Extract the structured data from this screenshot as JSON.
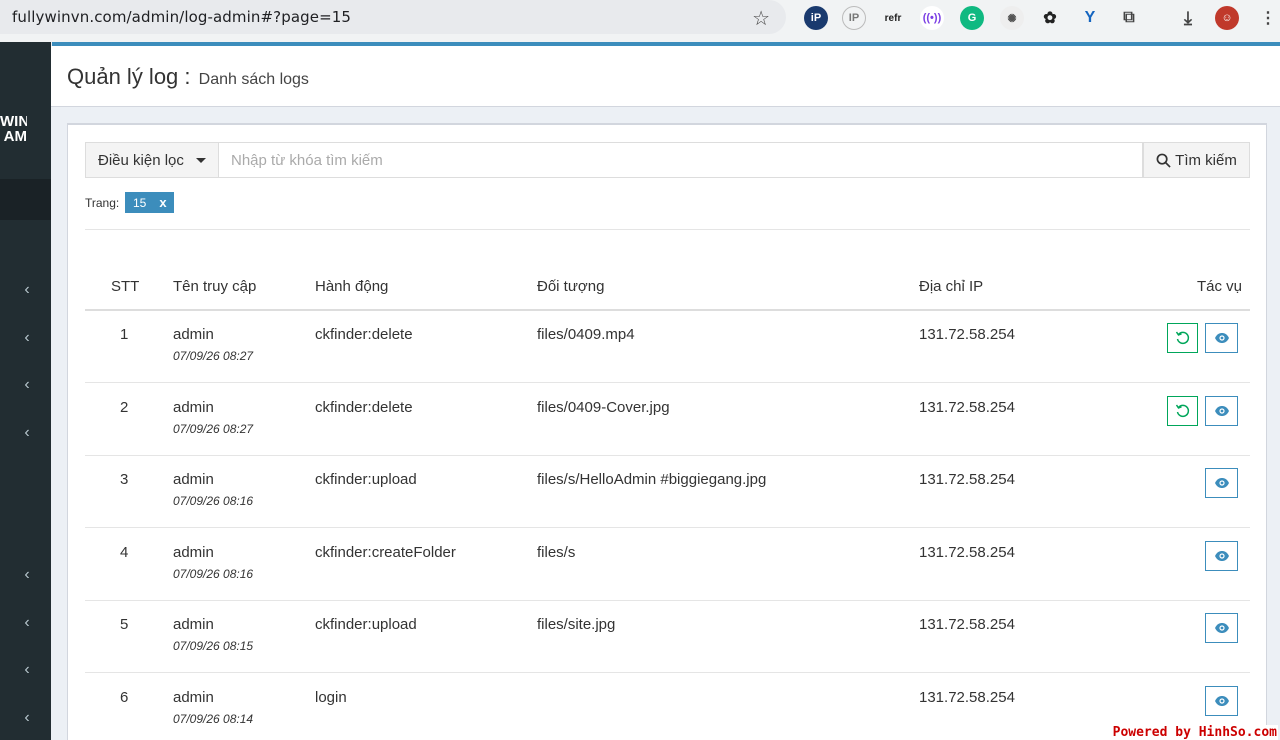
{
  "browser": {
    "url": "fullywinvn.com/admin/log-admin#?page=15",
    "extensions": [
      "iP",
      "IP",
      "refr",
      "signal",
      "G",
      "gear",
      "openai",
      "Y",
      "puzzle",
      "download",
      "avatar"
    ]
  },
  "sidebar": {
    "logo_line1": "WIN",
    "logo_line2": "AM"
  },
  "header": {
    "title": "Quản lý log :",
    "subtitle": "Danh sách logs"
  },
  "filter": {
    "dropdown_label": "Điều kiện lọc",
    "search_placeholder": "Nhập từ khóa tìm kiếm",
    "search_button": "Tìm kiếm",
    "page_label": "Trang:",
    "page_tag": "15",
    "page_tag_close": "x"
  },
  "table": {
    "headers": {
      "stt": "STT",
      "user": "Tên truy cập",
      "action": "Hành động",
      "object": "Đối tượng",
      "ip": "Địa chỉ IP",
      "tasks": "Tác vụ"
    },
    "rows": [
      {
        "stt": "1",
        "user": "admin",
        "time": "07/09/26 08:27",
        "action": "ckfinder:delete",
        "object": "files/0409.mp4",
        "ip": "131.72.58.254",
        "restore": true
      },
      {
        "stt": "2",
        "user": "admin",
        "time": "07/09/26 08:27",
        "action": "ckfinder:delete",
        "object": "files/0409-Cover.jpg",
        "ip": "131.72.58.254",
        "restore": true
      },
      {
        "stt": "3",
        "user": "admin",
        "time": "07/09/26 08:16",
        "action": "ckfinder:upload",
        "object": "files/s/HelloAdmin #biggiegang.jpg",
        "ip": "131.72.58.254",
        "restore": false
      },
      {
        "stt": "4",
        "user": "admin",
        "time": "07/09/26 08:16",
        "action": "ckfinder:createFolder",
        "object": "files/s",
        "ip": "131.72.58.254",
        "restore": false
      },
      {
        "stt": "5",
        "user": "admin",
        "time": "07/09/26 08:15",
        "action": "ckfinder:upload",
        "object": "files/site.jpg",
        "ip": "131.72.58.254",
        "restore": false
      },
      {
        "stt": "6",
        "user": "admin",
        "time": "07/09/26 08:14",
        "action": "login",
        "object": "",
        "ip": "131.72.58.254",
        "restore": false
      }
    ]
  },
  "watermark": "Powered by HinhSo.com",
  "colors": {
    "primary": "#3c8dbc",
    "success": "#00a65a",
    "sidebar": "#222d32"
  }
}
